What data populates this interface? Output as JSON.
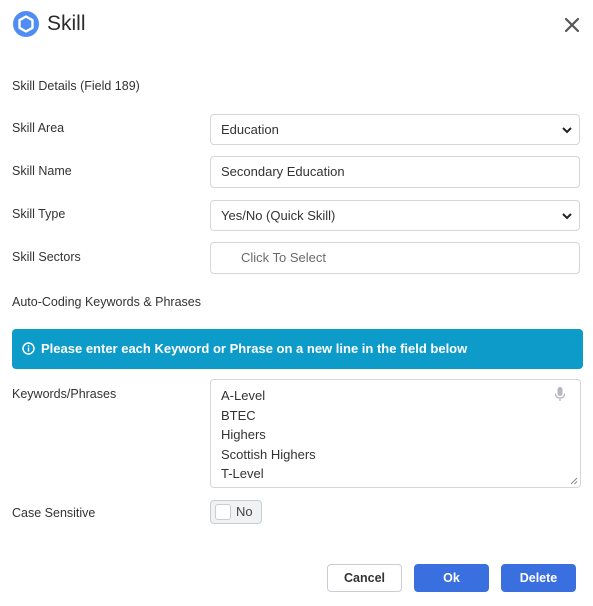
{
  "header": {
    "title": "Skill"
  },
  "section_title": "Skill Details (Field 189)",
  "fields": {
    "skill_area": {
      "label": "Skill Area",
      "value": "Education"
    },
    "skill_name": {
      "label": "Skill Name",
      "value": "Secondary Education"
    },
    "skill_type": {
      "label": "Skill Type",
      "value": "Yes/No (Quick Skill)"
    },
    "skill_sectors": {
      "label": "Skill Sectors",
      "placeholder": "Click To Select"
    }
  },
  "auto_coding": {
    "heading": "Auto-Coding Keywords & Phrases",
    "banner": "Please enter each Keyword or Phrase on a new line in the field below",
    "keywords_label": "Keywords/Phrases",
    "keywords": [
      "A-Level",
      "BTEC",
      "Highers",
      "Scottish Highers",
      "T-Level"
    ]
  },
  "case_sensitive": {
    "label": "Case Sensitive",
    "value": "No"
  },
  "buttons": {
    "cancel": "Cancel",
    "ok": "Ok",
    "delete": "Delete"
  },
  "colors": {
    "accent": "#3a6fe0",
    "banner": "#0d9bc9",
    "logo": "#4f8df5"
  },
  "icons": {
    "logo": "app-logo-icon",
    "close": "close-icon",
    "select": "chevron-down-icon",
    "info": "info-icon",
    "mic": "microphone-icon",
    "resize": "resize-handle-icon"
  }
}
